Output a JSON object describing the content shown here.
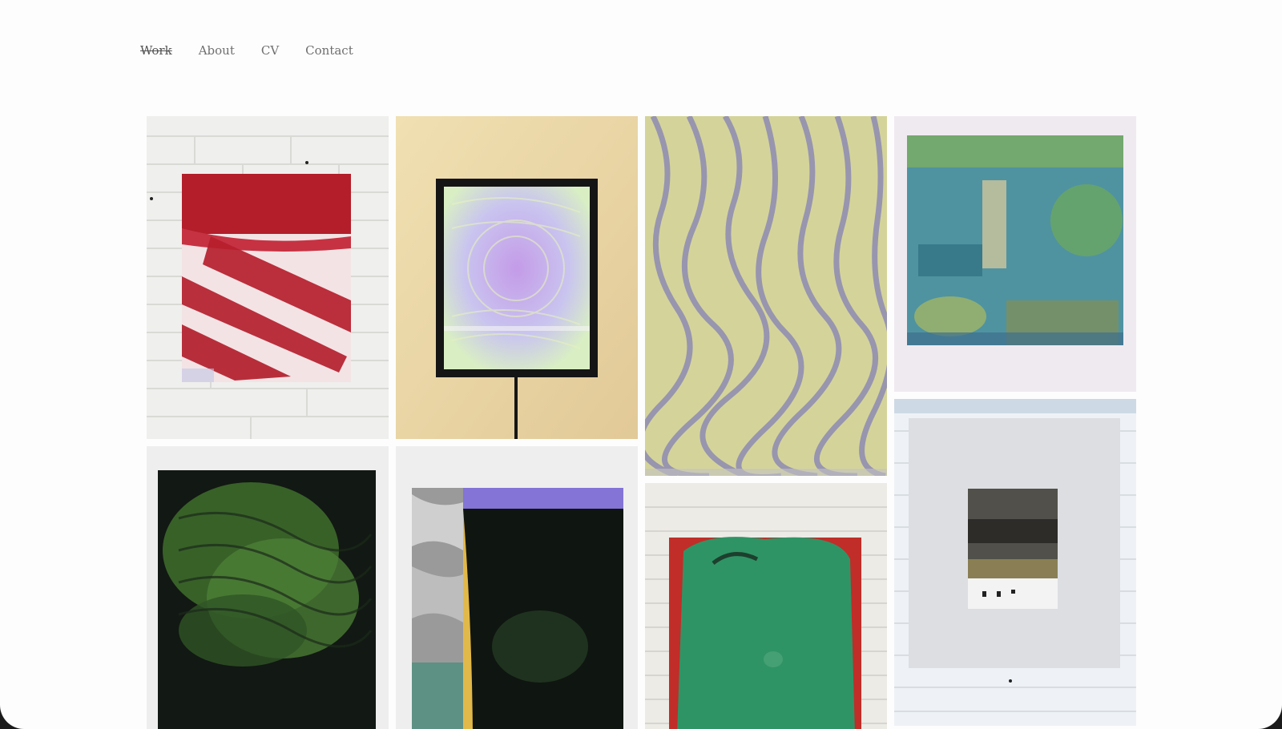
{
  "nav": {
    "items": [
      {
        "label": "Work",
        "active": true
      },
      {
        "label": "About",
        "active": false
      },
      {
        "label": "CV",
        "active": false
      },
      {
        "label": "Contact",
        "active": false
      }
    ]
  },
  "gallery": {
    "artworks": [
      {
        "id": "red-spray-painting",
        "colors": {
          "bg": "#f0f0ee",
          "canvas": "#b6202a",
          "light": "#f3e6e7"
        }
      },
      {
        "id": "lightbox-monitor",
        "colors": {
          "bg": "#efdcae",
          "frame": "#161616",
          "screen": "#c7b2ea"
        }
      },
      {
        "id": "yellow-blue-moire",
        "colors": {
          "bg": "#d2d295",
          "stripe": "#8a86b5"
        }
      },
      {
        "id": "teal-collage",
        "colors": {
          "bg": "#efeaf0",
          "canvas": "#4f93a1",
          "green": "#89ad57"
        }
      },
      {
        "id": "dark-green-moire",
        "colors": {
          "bg": "#eeeeee",
          "canvas": "#121813",
          "green": "#4e8137"
        }
      },
      {
        "id": "purple-black-collage",
        "colors": {
          "bg": "#eeeeee",
          "purple": "#8374d6",
          "black": "#0f1510",
          "yellow": "#e1b84a"
        }
      },
      {
        "id": "green-red-painting",
        "colors": {
          "bg": "#ecebe6",
          "red": "#c12d28",
          "green": "#2f9465"
        }
      },
      {
        "id": "white-photo-painting",
        "colors": {
          "bg": "#e6ecf2",
          "canvas": "#dcdee2",
          "photo": "#51504a"
        }
      }
    ]
  }
}
